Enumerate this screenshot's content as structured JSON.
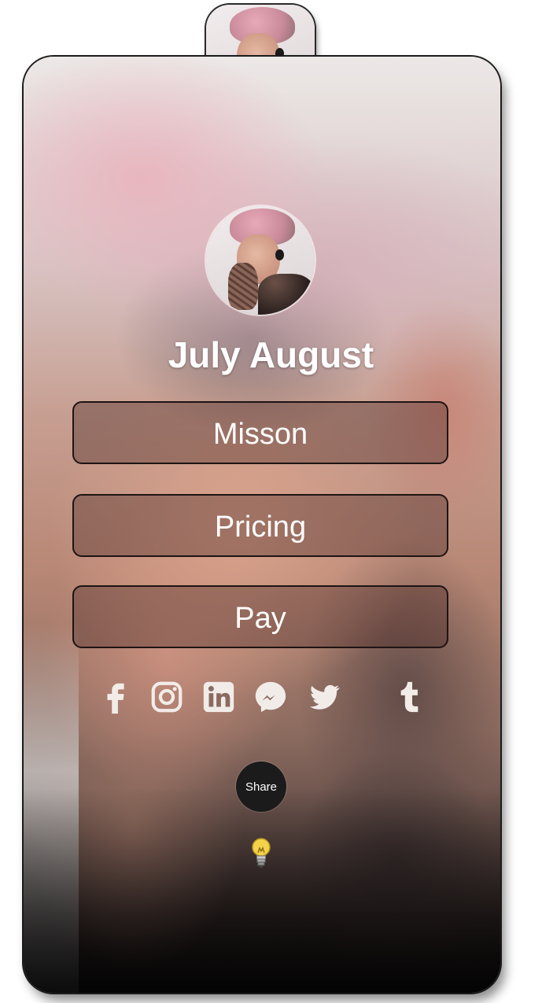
{
  "profile": {
    "name": "July August"
  },
  "links": [
    {
      "label": "Misson"
    },
    {
      "label": "Pricing"
    },
    {
      "label": "Pay"
    }
  ],
  "socials": [
    {
      "icon": "facebook-icon"
    },
    {
      "icon": "instagram-icon"
    },
    {
      "icon": "linkedin-icon"
    },
    {
      "icon": "messenger-icon"
    },
    {
      "icon": "twitter-icon"
    },
    {
      "icon": "tumblr-icon"
    }
  ],
  "share": {
    "label": "Share"
  },
  "hint": {
    "icon": "lightbulb-icon"
  },
  "colors": {
    "text": "#ffffff",
    "button_border": "#1e1414",
    "share_bg": "#1b1b1b"
  }
}
